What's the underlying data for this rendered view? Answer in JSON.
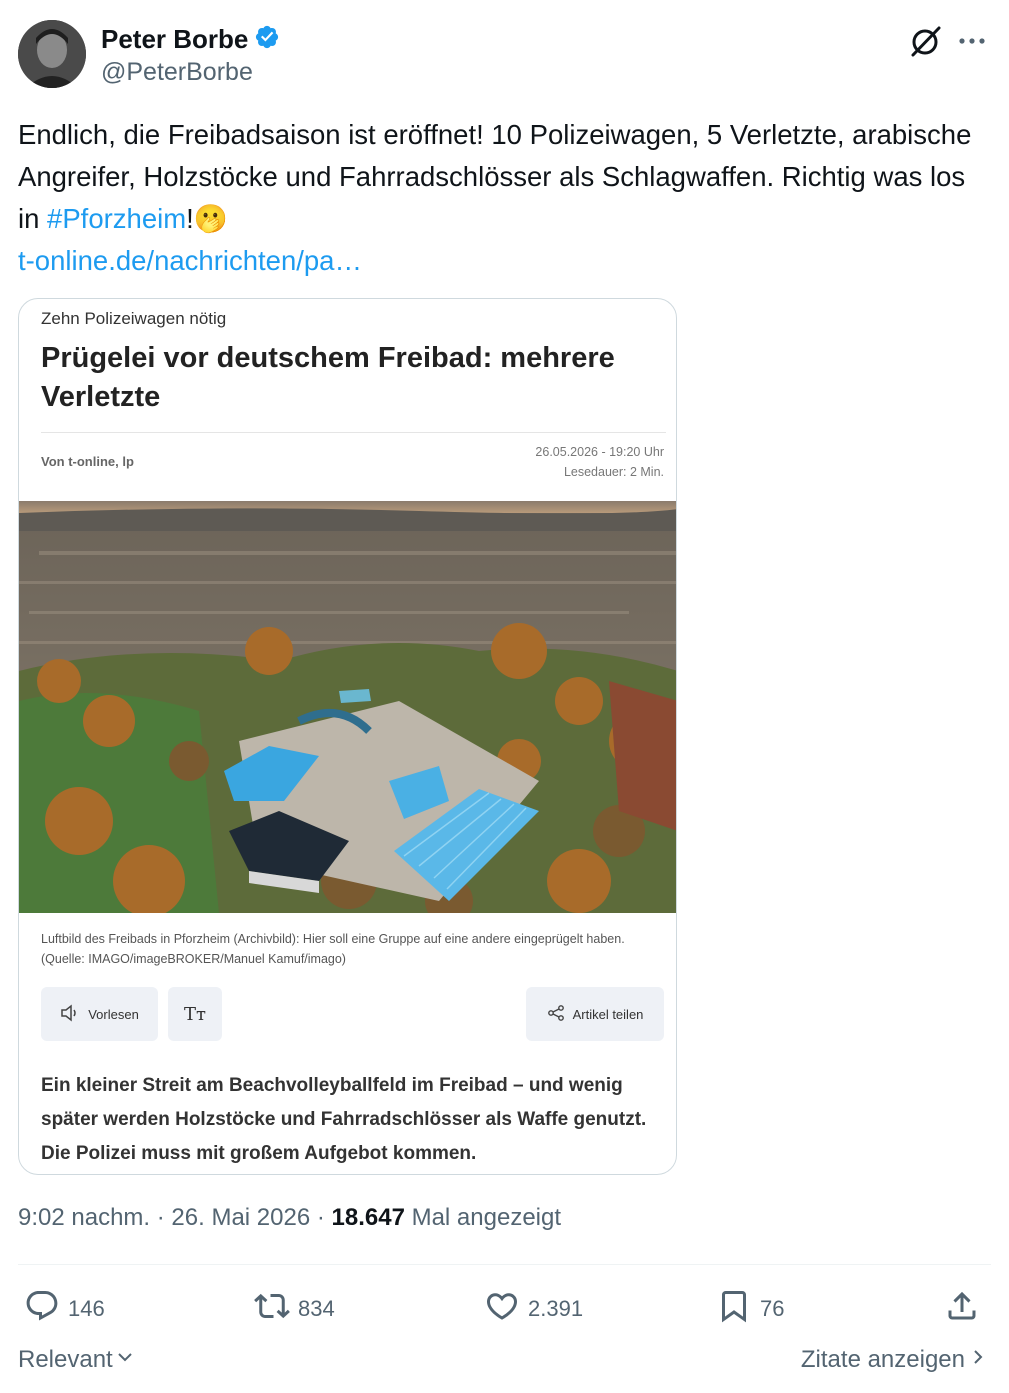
{
  "author": {
    "name": "Peter Borbe",
    "handle": "@PeterBorbe"
  },
  "tweet": {
    "text_part1": "Endlich, die Freibadsaison ist eröffnet! 10 Polizeiwagen, 5 Verletzte, arabische Angreifer, Holzstöcke und Fahrradschlösser als Schlagwaffen. Richtig was los in ",
    "hashtag": "#Pforzheim",
    "text_part2": "!",
    "emoji": "🫢",
    "link": "t-online.de/nachrichten/pa…"
  },
  "card": {
    "kicker": "Zehn Polizeiwagen nötig",
    "headline": "Prügelei vor deutschem Freibad: mehrere Verletzte",
    "author": "Von t-online, lp",
    "date": "26.05.2026 - 19:20 Uhr",
    "read_time": "Lesedauer: 2 Min.",
    "caption": "Luftbild des Freibads in Pforzheim (Archivbild): Hier soll eine Gruppe auf eine andere eingeprügelt haben. (Quelle: IMAGO/imageBROKER/Manuel Kamuf/imago)",
    "btn_read": "Vorlesen",
    "btn_text": "Tт",
    "btn_share": "Artikel teilen",
    "lead": "Ein kleiner Streit am Beachvolleyballfeld im Freibad – und wenig später werden Holzstöcke und Fahrradschlösser als Waffe genutzt. Die Polizei muss mit großem Aufgebot kommen."
  },
  "meta": {
    "time": "9:02 nachm.",
    "sep1": " · ",
    "date": "26. Mai 2026",
    "sep2": " · ",
    "views": "18.647",
    "views_label": " Mal angezeigt"
  },
  "actions": {
    "replies": "146",
    "retweets": "834",
    "likes": "2.391",
    "bookmarks": "76"
  },
  "footer": {
    "relevant": "Relevant",
    "quotes": "Zitate anzeigen"
  },
  "colors": {
    "accent": "#1d9bf0",
    "secondary_text": "#536471",
    "verified": "#1d9bf0"
  }
}
